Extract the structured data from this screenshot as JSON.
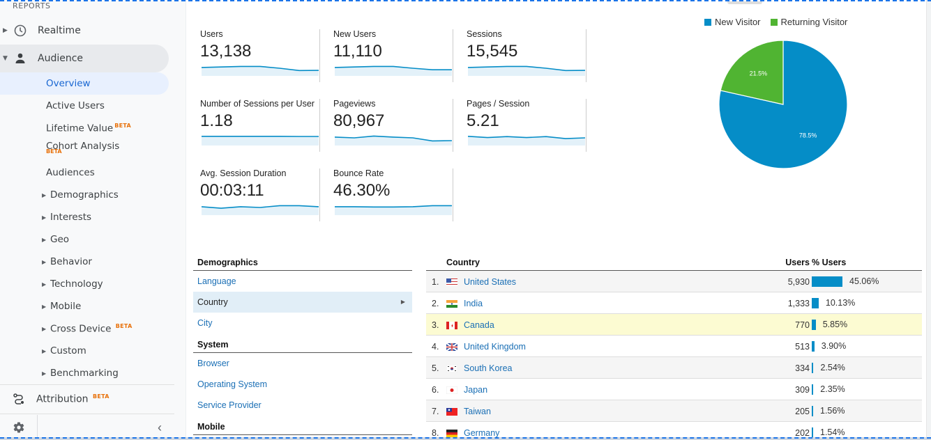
{
  "sidebar": {
    "section_label": "REPORTS",
    "realtime": "Realtime",
    "audience": "Audience",
    "items": [
      {
        "label": "Overview"
      },
      {
        "label": "Active Users"
      },
      {
        "label": "Lifetime Value",
        "badge": "BETA"
      },
      {
        "label": "Cohort Analysis",
        "badge": "BETA"
      },
      {
        "label": "Audiences"
      },
      {
        "label": "Demographics"
      },
      {
        "label": "Interests"
      },
      {
        "label": "Geo"
      },
      {
        "label": "Behavior"
      },
      {
        "label": "Technology"
      },
      {
        "label": "Mobile"
      },
      {
        "label": "Cross Device",
        "badge": "BETA"
      },
      {
        "label": "Custom"
      },
      {
        "label": "Benchmarking"
      }
    ],
    "attribution": "Attribution",
    "attribution_badge": "BETA",
    "collapse_glyph": "‹"
  },
  "metrics": [
    {
      "label": "Users",
      "value": "13,138",
      "trend": [
        0.55,
        0.58,
        0.62,
        0.62,
        0.5,
        0.35,
        0.36
      ]
    },
    {
      "label": "New Users",
      "value": "11,110",
      "trend": [
        0.55,
        0.58,
        0.62,
        0.62,
        0.5,
        0.4,
        0.4
      ]
    },
    {
      "label": "Sessions",
      "value": "15,545",
      "trend": [
        0.55,
        0.58,
        0.62,
        0.62,
        0.5,
        0.35,
        0.36
      ]
    },
    {
      "label": "Number of Sessions per User",
      "value": "1.18",
      "trend": [
        0.6,
        0.6,
        0.6,
        0.6,
        0.6,
        0.59,
        0.59
      ]
    },
    {
      "label": "Pageviews",
      "value": "80,967",
      "trend": [
        0.55,
        0.5,
        0.62,
        0.55,
        0.5,
        0.3,
        0.32
      ]
    },
    {
      "label": "Pages / Session",
      "value": "5.21",
      "trend": [
        0.6,
        0.52,
        0.58,
        0.52,
        0.58,
        0.45,
        0.5
      ]
    },
    {
      "label": "Avg. Session Duration",
      "value": "00:03:11",
      "trend": [
        0.55,
        0.45,
        0.55,
        0.5,
        0.62,
        0.62,
        0.55
      ]
    },
    {
      "label": "Bounce Rate",
      "value": "46.30%",
      "trend": [
        0.55,
        0.55,
        0.53,
        0.53,
        0.55,
        0.62,
        0.62
      ]
    }
  ],
  "chart_data": {
    "type": "pie",
    "title": "",
    "legend_position": "top",
    "series": [
      {
        "name": "New Visitor",
        "value": 78.5,
        "label": "78.5%",
        "color": "#058dc7"
      },
      {
        "name": "Returning Visitor",
        "value": 21.5,
        "label": "21.5%",
        "color": "#50b432"
      }
    ]
  },
  "demographics": {
    "sections": [
      {
        "title": "Demographics",
        "items": [
          "Language",
          "Country",
          "City"
        ]
      },
      {
        "title": "System",
        "items": [
          "Browser",
          "Operating System",
          "Service Provider"
        ]
      },
      {
        "title": "Mobile",
        "items": []
      }
    ],
    "selected": "Country"
  },
  "country_table": {
    "headers": {
      "country": "Country",
      "users": "Users",
      "pct_users": "% Users"
    },
    "rows": [
      {
        "rank": "1.",
        "country": "United States",
        "flag": "us",
        "users": "5,930",
        "pct": "45.06%",
        "pct_value": 45.06
      },
      {
        "rank": "2.",
        "country": "India",
        "flag": "in",
        "users": "1,333",
        "pct": "10.13%",
        "pct_value": 10.13
      },
      {
        "rank": "3.",
        "country": "Canada",
        "flag": "ca",
        "users": "770",
        "pct": "5.85%",
        "pct_value": 5.85
      },
      {
        "rank": "4.",
        "country": "United Kingdom",
        "flag": "gb",
        "users": "513",
        "pct": "3.90%",
        "pct_value": 3.9
      },
      {
        "rank": "5.",
        "country": "South Korea",
        "flag": "kr",
        "users": "334",
        "pct": "2.54%",
        "pct_value": 2.54
      },
      {
        "rank": "6.",
        "country": "Japan",
        "flag": "jp",
        "users": "309",
        "pct": "2.35%",
        "pct_value": 2.35
      },
      {
        "rank": "7.",
        "country": "Taiwan",
        "flag": "tw",
        "users": "205",
        "pct": "1.56%",
        "pct_value": 1.56
      },
      {
        "rank": "8.",
        "country": "Germany",
        "flag": "de",
        "users": "202",
        "pct": "1.54%",
        "pct_value": 1.54
      }
    ],
    "highlighted_row": 2
  }
}
